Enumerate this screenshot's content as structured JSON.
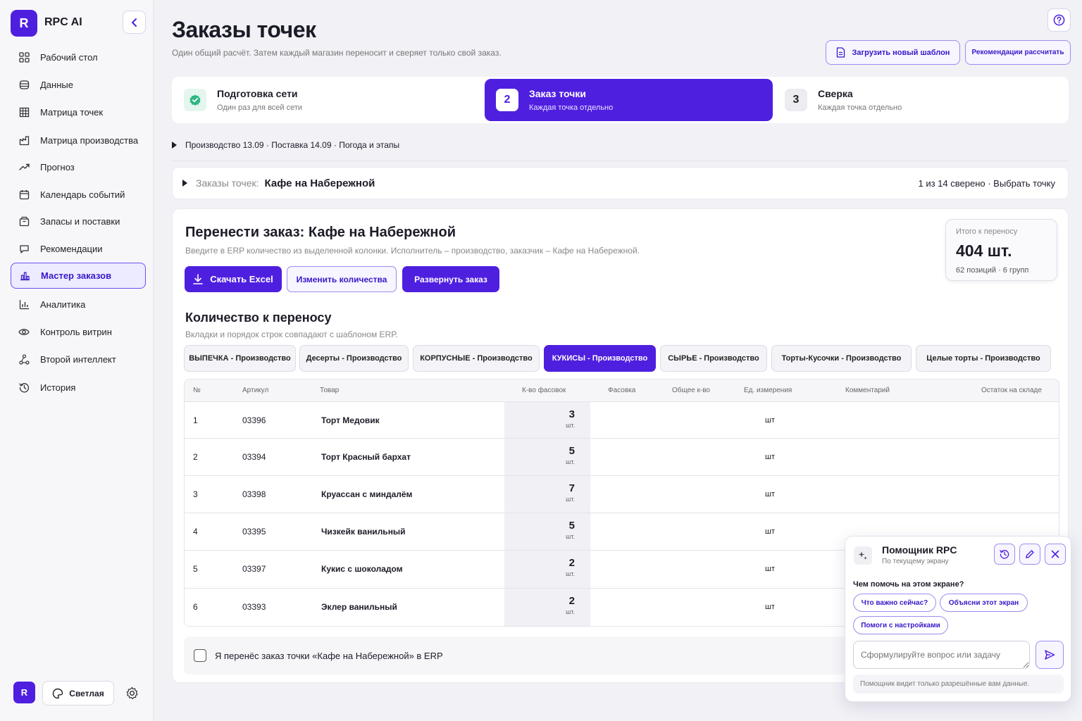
{
  "app": {
    "logo_letter": "R",
    "name": "RPC AI"
  },
  "sidebar": {
    "items": [
      {
        "label": "Рабочий стол",
        "icon": "dashboard-icon"
      },
      {
        "label": "Данные",
        "icon": "database-icon"
      },
      {
        "label": "Матрица точек",
        "icon": "grid-icon"
      },
      {
        "label": "Матрица производства",
        "icon": "factory-icon"
      },
      {
        "label": "Прогноз",
        "icon": "trend-icon"
      },
      {
        "label": "Календарь событий",
        "icon": "calendar-icon"
      },
      {
        "label": "Запасы и поставки",
        "icon": "box-icon"
      },
      {
        "label": "Рекомендации",
        "icon": "chat-icon"
      },
      {
        "label": "Мастер заказов",
        "icon": "bar-chart-icon",
        "active": true
      },
      {
        "label": "Аналитика",
        "icon": "analytics-icon"
      },
      {
        "label": "Контроль витрин",
        "icon": "eye-icon"
      },
      {
        "label": "Второй интеллект",
        "icon": "nodes-icon"
      },
      {
        "label": "История",
        "icon": "history-icon"
      }
    ],
    "avatar": "R",
    "theme_label": "Светлая"
  },
  "header": {
    "title": "Заказы точек",
    "subtitle": "Один общий расчёт. Затем каждый магазин переносит и сверяет только свой заказ.",
    "upload_label": "Загрузить новый шаблон",
    "recommend_label": "Рекомендации рассчитать"
  },
  "steps": [
    {
      "num": "✓",
      "title": "Подготовка сети",
      "sub": "Один раз для всей сети"
    },
    {
      "num": "2",
      "title": "Заказ точки",
      "sub": "Каждая точка отдельно"
    },
    {
      "num": "3",
      "title": "Сверка",
      "sub": "Каждая точка отдельно"
    }
  ],
  "production_line": "Производство 13.09 · Поставка 14.09 · Погода и этапы",
  "store_bar": {
    "label": "Заказы точек:",
    "store": "Кафе на Набережной",
    "progress": "1 из 14 сверено · Выбрать точку"
  },
  "transfer": {
    "title": "Перенести заказ: Кафе на Набережной",
    "subtitle": "Введите в ERP количество из выделенной колонки. Исполнитель – производство, заказчик – Кафе на Набережной.",
    "download_label": "Скачать Excel",
    "edit_label": "Изменить количества",
    "expand_label": "Развернуть заказ",
    "total_label": "Итого к переносу",
    "total_value": "404 шт.",
    "total_meta": "62 позиций · 6 групп"
  },
  "quantity": {
    "title": "Количество к переносу",
    "subtitle": "Вкладки и порядок строк совпадают с шаблоном ERP.",
    "tabs": [
      "ВЫПЕЧКА - Производство",
      "Десерты - Производство",
      "КОРПУСНЫЕ - Производство",
      "КУКИСЫ - Производство",
      "СЫРЬЕ - Производство",
      "Торты-Кусочки - Производство",
      "Целые торты - Производство"
    ],
    "active_tab": 3
  },
  "table": {
    "columns": [
      "№",
      "Артикул",
      "Товар",
      "К-во фасовок",
      "Фасовка",
      "Общее к-во",
      "Ед. измерения",
      "Комментарий",
      "Остаток на складе"
    ],
    "rows": [
      {
        "n": "1",
        "sku": "03396",
        "name": "Торт Медовик",
        "qty": "3",
        "qty_unit": "шт.",
        "unit": "шт"
      },
      {
        "n": "2",
        "sku": "03394",
        "name": "Торт Красный бархат",
        "qty": "5",
        "qty_unit": "шт.",
        "unit": "шт"
      },
      {
        "n": "3",
        "sku": "03398",
        "name": "Круассан с миндалём",
        "qty": "7",
        "qty_unit": "шт.",
        "unit": "шт"
      },
      {
        "n": "4",
        "sku": "03395",
        "name": "Чизкейк ванильный",
        "qty": "5",
        "qty_unit": "шт.",
        "unit": "шт"
      },
      {
        "n": "5",
        "sku": "03397",
        "name": "Кукис с шоколадом",
        "qty": "2",
        "qty_unit": "шт.",
        "unit": "шт"
      },
      {
        "n": "6",
        "sku": "03393",
        "name": "Эклер ванильный",
        "qty": "2",
        "qty_unit": "шт.",
        "unit": "шт"
      }
    ]
  },
  "confirm_label": "Я перенёс заказ точки «Кафе на Набережной» в ERP",
  "assistant": {
    "title": "Помощник RPC",
    "subtitle": "По текущему экрану",
    "question": "Чем помочь на этом экране?",
    "chips": [
      "Что важно сейчас?",
      "Объясни этот экран",
      "Помоги с настройками"
    ],
    "placeholder": "Сформулируйте вопрос или задачу",
    "note": "Помощник видит только разрешённые вам данные."
  },
  "colors": {
    "accent": "#4f1fe0",
    "accent_light": "#ecebff",
    "border_accent": "#9d8cf0",
    "success": "#2fb783"
  }
}
